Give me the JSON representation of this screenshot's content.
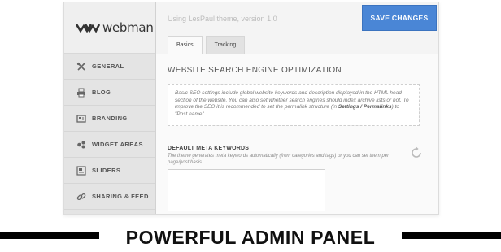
{
  "brand": {
    "logo_text": "webman"
  },
  "header": {
    "theme_version": "Using LesPaul theme, version 1.0",
    "save_label": "SAVE CHANGES"
  },
  "sidebar": {
    "items": [
      {
        "label": "GENERAL",
        "icon": "tools-icon"
      },
      {
        "label": "BLOG",
        "icon": "printer-icon"
      },
      {
        "label": "BRANDING",
        "icon": "brand-card-icon"
      },
      {
        "label": "WIDGET AREAS",
        "icon": "puzzle-icon"
      },
      {
        "label": "SLIDERS",
        "icon": "slides-icon"
      },
      {
        "label": "SHARING & FEED",
        "icon": "link-icon"
      }
    ]
  },
  "tabs": [
    {
      "label": "Basics"
    },
    {
      "label": "Tracking"
    }
  ],
  "main": {
    "section_title": "WEBSITE SEARCH ENGINE OPTIMIZATION",
    "info_part1": "Basic SEO settings include global website keywords and description displayed in the HTML head section of the website. You can also set whether search engines should index archive lists or not. To improve the SEO it is recommended to set the permalink structure (in ",
    "info_bold": "Settings / Permalinks",
    "info_part2": ") to \"Post name\".",
    "field_label": "DEFAULT META KEYWORDS",
    "field_desc": "The theme generates meta keywords automatically (from categories and tags) or you can set them per page/post basis.",
    "field_value": ""
  },
  "banner": {
    "text": "POWERFUL ADMIN PANEL"
  },
  "colors": {
    "accent": "#4a86d6",
    "sidebar_bg": "#e4e4e4"
  }
}
